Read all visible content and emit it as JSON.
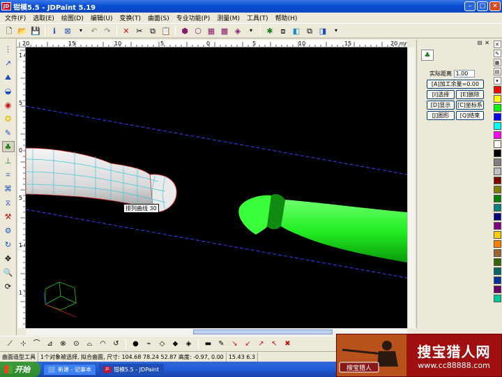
{
  "window": {
    "title": "钳模5.5 - JDPaint 5.19"
  },
  "menu": [
    "文件(F)",
    "选取(E)",
    "绘图(D)",
    "编辑(U)",
    "变换(T)",
    "曲面(S)",
    "专业功能(P)",
    "测量(M)",
    "工具(T)",
    "帮助(H)"
  ],
  "viewport": {
    "curve_tag": "排列曲线 30",
    "ruler_top": [
      "20",
      "15",
      "10",
      "5",
      "0",
      "5",
      "10",
      "15",
      "20 mm"
    ],
    "ruler_left": [
      "1 0",
      "5",
      "0",
      "5",
      "1 0",
      "1 5"
    ]
  },
  "right_panel": {
    "offset_label": "实际距离",
    "offset_value": "1.00",
    "btn_full": "[A]加工余量=0.00",
    "btn_select": "[I]选择",
    "btn_delete": "[E]删除",
    "btn_show": "[D]显示",
    "btn_coord": "[C]坐标系",
    "btn_graph": "[J]图形",
    "btn_exit": "[Q]结束"
  },
  "palette_colors": [
    "#ff0000",
    "#ffff00",
    "#00ff00",
    "#0000ff",
    "#00ffff",
    "#ff00ff",
    "#ffffff",
    "#000000",
    "#808080",
    "#c0c0c0",
    "#800000",
    "#808000",
    "#008000",
    "#008080",
    "#000080",
    "#800080",
    "#ffcc00",
    "#ff8000",
    "#996633",
    "#336600",
    "#006666",
    "#003399",
    "#660066",
    "#00cc99"
  ],
  "status": {
    "mode": "曲面造型工具",
    "message": "1个对象被选择, 拟合曲面, 尺寸: 104.68 78.24 52.87 高度: -0.97, 0.00",
    "coords": "15.43 6.3"
  },
  "taskbar": {
    "start": "开始",
    "items": [
      "新建 - 记事本",
      "钳模5.5 - JDPaint"
    ]
  },
  "watermark": {
    "title": "搜宝猎人网",
    "url": "www.cc88888.com",
    "tag": "搜宝猎人"
  }
}
